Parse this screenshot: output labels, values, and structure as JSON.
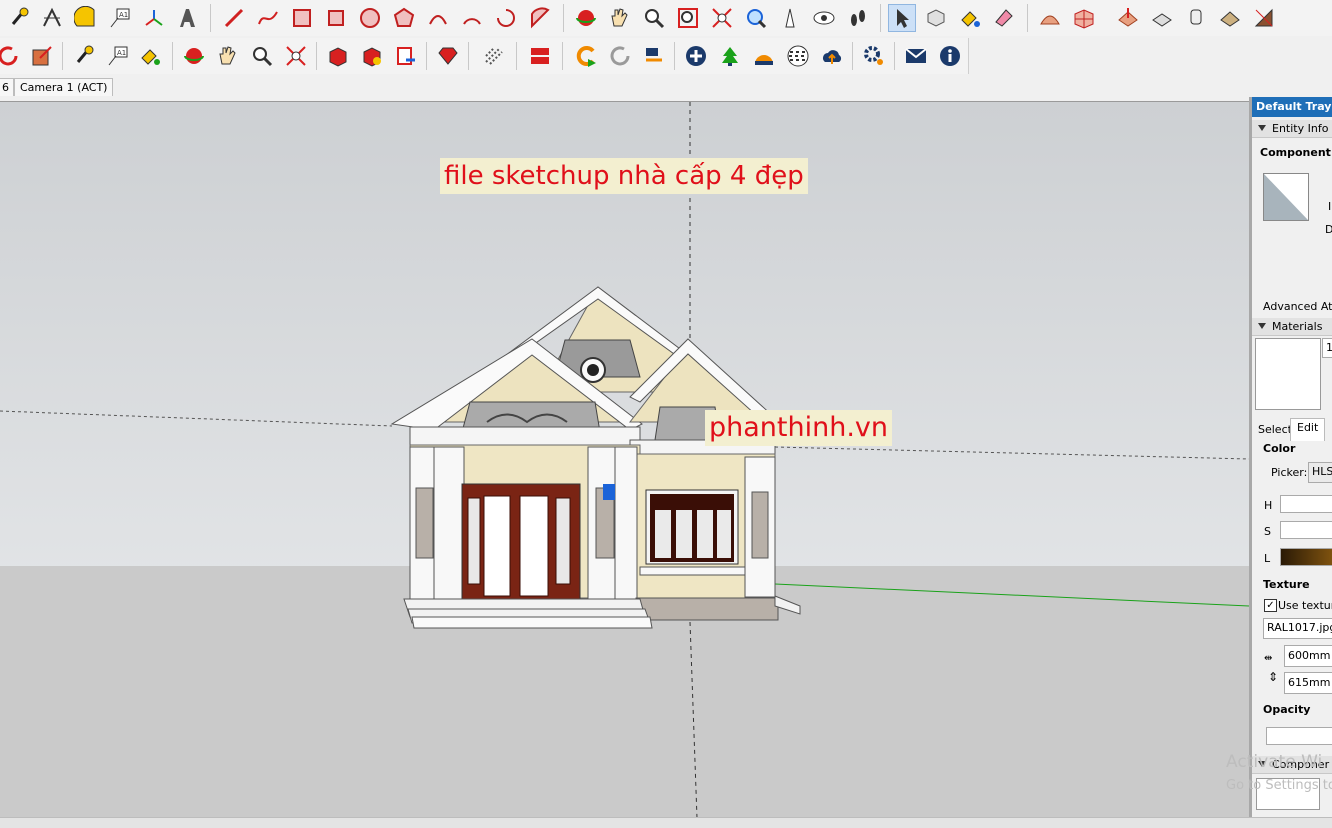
{
  "scene_tabs": [
    "6",
    "Camera 1 (ACT)"
  ],
  "viewport": {
    "label_top": "file sketchup nhà cấp 4 đẹp",
    "label_side": "phanthinh.vn"
  },
  "tray": {
    "title": "Default Tray",
    "entity_info": "Entity Info",
    "component_label": "Component (",
    "e_letter": "I",
    "d_letter": "D",
    "advanced_attr": "Advanced Attr",
    "materials": "Materials",
    "materials_num": "1",
    "tab_select": "Select",
    "tab_edit": "Edit",
    "color": "Color",
    "picker_label": "Picker:",
    "picker_value": "HLS",
    "h": "H",
    "s": "S",
    "l": "L",
    "texture": "Texture",
    "use_texture": "Use texture",
    "texture_file": "RAL1017.jpg",
    "width": "600mm",
    "height": "615mm",
    "opacity": "Opacity",
    "components": "Componer"
  },
  "watermark": {
    "line1": "Activate Wi",
    "line2": "Go to Settings to"
  },
  "colors": {
    "accent": "#1f6fb8",
    "label_red": "#e0101a",
    "banner_bg": "#f3efd0"
  }
}
